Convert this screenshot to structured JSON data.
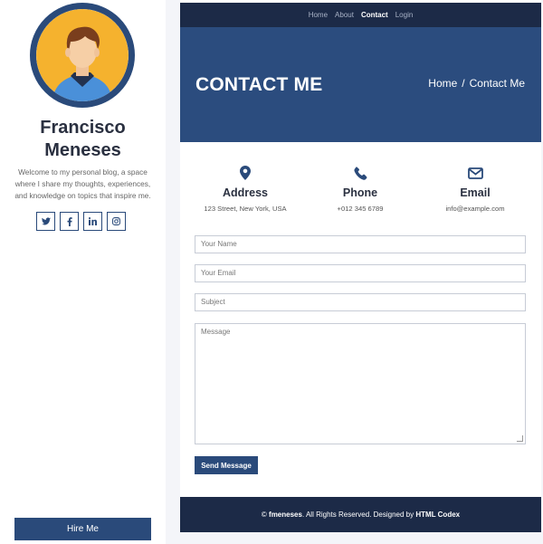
{
  "sidebar": {
    "name_line1": "Francisco",
    "name_line2": "Meneses",
    "bio": "Welcome to my personal blog, a space where I share my thoughts, experiences, and knowledge on topics that inspire me.",
    "socials": [
      "twitter-icon",
      "facebook-icon",
      "linkedin-icon",
      "instagram-icon"
    ],
    "hire_label": "Hire Me"
  },
  "nav": {
    "items": [
      "Home",
      "About",
      "Contact",
      "Login"
    ],
    "active": "Contact"
  },
  "hero": {
    "title": "CONTACT ME",
    "breadcrumb_home": "Home",
    "breadcrumb_sep": "/",
    "breadcrumb_current": "Contact Me"
  },
  "info": {
    "address_title": "Address",
    "address_value": "123 Street, New York, USA",
    "phone_title": "Phone",
    "phone_value": "+012 345 6789",
    "email_title": "Email",
    "email_value": "info@example.com"
  },
  "form": {
    "name_placeholder": "Your Name",
    "email_placeholder": "Your Email",
    "subject_placeholder": "Subject",
    "message_placeholder": "Message",
    "send_label": "Send Message"
  },
  "footer": {
    "copyright": "©",
    "brand": "fmeneses",
    "mid": ". All Rights Reserved. Designed by",
    "designer": "HTML Codex"
  },
  "colors": {
    "navy": "#1c2a47",
    "accent": "#2a4a7a",
    "hero_bg": "#2b4c7e",
    "avatar_bg": "#f5b22e"
  }
}
